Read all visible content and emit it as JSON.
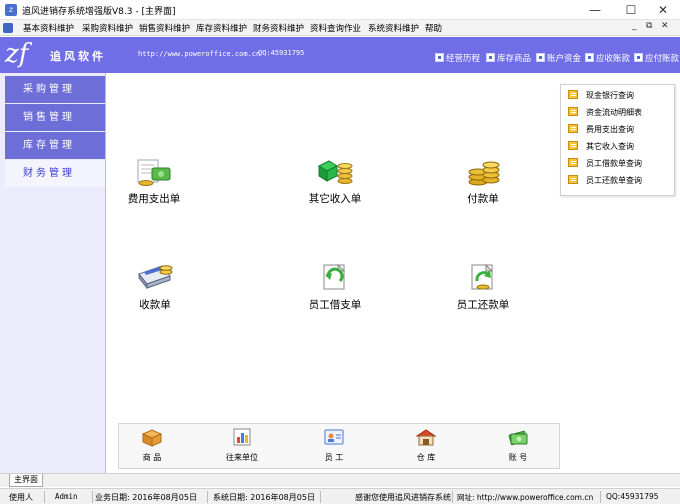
{
  "window": {
    "title": "追风进销存系统增强版V8.3 - [主界面]",
    "minimize": "—",
    "maximize": "☐",
    "close": "✕"
  },
  "menubar": {
    "items": [
      "基本资料维护",
      "采购资料维护",
      "销售资料维护",
      "库存资料维护",
      "财务资料维护",
      "资料查询作业",
      "系统资料维护",
      "帮助"
    ],
    "mdi_controls": [
      "_",
      "⧉",
      "✕"
    ]
  },
  "banner": {
    "logo": "zf",
    "company": "追风软件",
    "url": "http://www.poweroffice.com.cn",
    "qq": "QQ:45931795",
    "quick_links": [
      "经营历程",
      "库存商品",
      "账户资金",
      "应收账款",
      "应付账款"
    ]
  },
  "leftnav": {
    "items": [
      "采购管理",
      "销售管理",
      "库存管理",
      "财务管理"
    ],
    "active_index": 3
  },
  "main": {
    "operations": [
      "费用支出单",
      "其它收入单",
      "付款单",
      "收款单",
      "员工借支单",
      "员工还款单"
    ]
  },
  "query_panel": {
    "items": [
      "现金银行查询",
      "资金流动明细表",
      "费用支出查询",
      "其它收入查询",
      "员工借款单查询",
      "员工还款单查询"
    ]
  },
  "bottom_bar": {
    "items": [
      "商  品",
      "往来单位",
      "员  工",
      "仓  库",
      "账  号"
    ]
  },
  "tabs": {
    "active": "主界面"
  },
  "status": {
    "user_label": "使用人",
    "user": "Admin",
    "biz_date": "业务日期: 2016年08月05日",
    "sys_date": "系统日期: 2016年08月05日",
    "thanks": "感谢您使用追风进销存系统",
    "site": "网址: http://www.poweroffice.com.cn",
    "qq": "QQ:45931795"
  },
  "colors": {
    "banner": "#6f6ee6",
    "nav_item": "#6e6ed9",
    "nav_bg": "#ececfc"
  }
}
